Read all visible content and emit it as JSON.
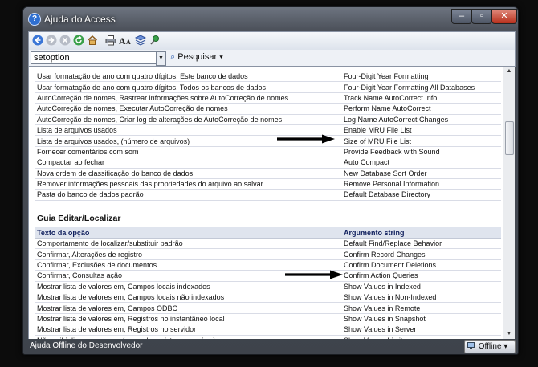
{
  "window": {
    "title": "Ajuda do Access",
    "app_icon": "?",
    "minimize_glyph": "–",
    "maximize_glyph": "▫",
    "close_glyph": "✕"
  },
  "toolbar": {
    "icons": [
      "back-icon",
      "forward-icon",
      "stop-icon",
      "refresh-icon",
      "home-icon",
      "print-icon",
      "font-size-icon",
      "toc-icon",
      "keep-on-top-icon"
    ]
  },
  "search": {
    "value": "setoption",
    "button_label": "Pesquisar",
    "button_glyph": "⌕",
    "menu_glyph": "▾",
    "dropdown_glyph": "▼"
  },
  "top_table": {
    "rows": [
      [
        "Usar formatação de ano com quatro dígitos, Este banco de dados",
        "Four-Digit Year Formatting"
      ],
      [
        "Usar formatação de ano com quatro dígitos, Todos os bancos de dados",
        "Four-Digit Year Formatting All Databases"
      ],
      [
        "AutoCorreção de nomes, Rastrear informações sobre AutoCorreção de nomes",
        "Track Name AutoCorrect Info"
      ],
      [
        "AutoCorreção de nomes, Executar AutoCorreção de nomes",
        "Perform Name AutoCorrect"
      ],
      [
        "AutoCorreção de nomes, Criar log de alterações de AutoCorreção de nomes",
        "Log Name AutoCorrect Changes"
      ],
      [
        "Lista de arquivos usados",
        "Enable MRU File List"
      ],
      [
        "Lista de arquivos usados, (número de arquivos)",
        "Size of MRU File List"
      ],
      [
        "Fornecer comentários com som",
        "Provide Feedback with Sound"
      ],
      [
        "Compactar ao fechar",
        "Auto Compact"
      ],
      [
        "Nova ordem de classificação do banco de dados",
        "New Database Sort Order"
      ],
      [
        "Remover informações pessoais das propriedades do arquivo ao salvar",
        "Remove Personal Information"
      ],
      [
        "Pasta do banco de dados padrão",
        "Default Database Directory"
      ]
    ]
  },
  "section": {
    "title": "Guia Editar/Localizar"
  },
  "bottom_table": {
    "headers": [
      "Texto da opção",
      "Argumento string"
    ],
    "rows": [
      [
        "Comportamento de localizar/substituir padrão",
        "Default Find/Replace Behavior"
      ],
      [
        "Confirmar, Alterações de registro",
        "Confirm Record Changes"
      ],
      [
        "Confirmar, Exclusões de documentos",
        "Confirm Document Deletions"
      ],
      [
        "Confirmar, Consultas ação",
        "Confirm Action Queries"
      ],
      [
        "Mostrar lista de valores em, Campos locais indexados",
        "Show Values in Indexed"
      ],
      [
        "Mostrar lista de valores em, Campos locais não indexados",
        "Show Values in Non-Indexed"
      ],
      [
        "Mostrar lista de valores em, Campos ODBC",
        "Show Values in Remote"
      ],
      [
        "Mostrar lista de valores em, Registros no instantâneo local",
        "Show Values in Snapshot"
      ],
      [
        "Mostrar lista de valores em, Registros no servidor",
        "Show Values in Server"
      ],
      [
        "Não exibir listas com um número de registros superior à",
        "Show Values Limit"
      ]
    ]
  },
  "status": {
    "text": "Ajuda Offline do Desenvolvedor",
    "offline_label": "Offline",
    "offline_glyph": "▾"
  },
  "colors": {
    "header_text": "#11205e",
    "header_bg": "#dfe4ee"
  }
}
